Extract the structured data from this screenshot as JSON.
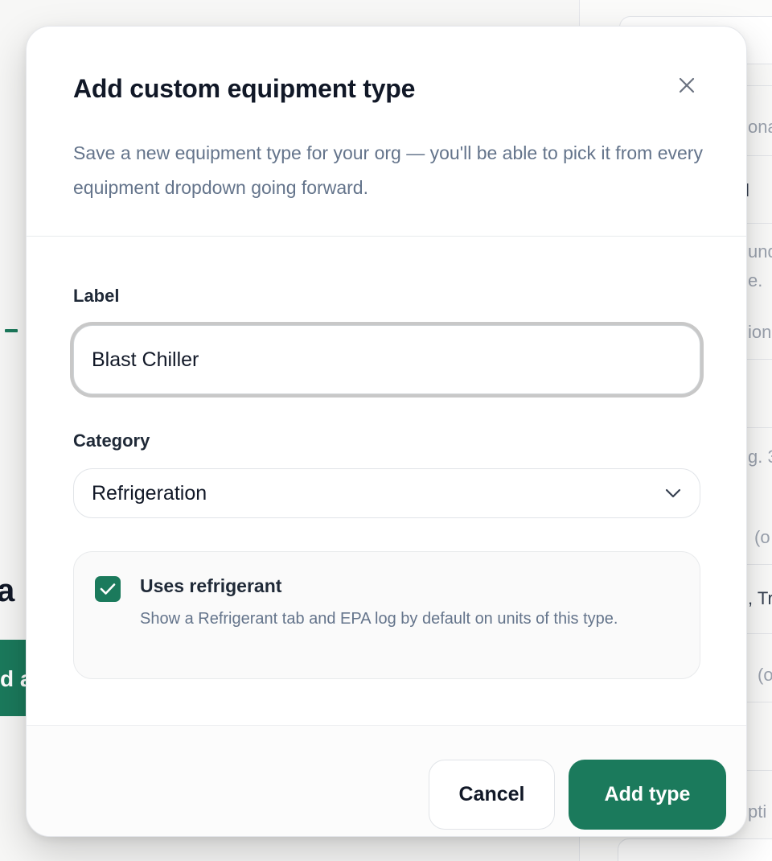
{
  "background": {
    "left_big_text": "a",
    "left_button_text": "d a",
    "right_fragments": [
      "ona",
      "l",
      "und",
      "e.",
      "ion",
      "g. 3",
      "(o",
      ", Tr",
      "(o",
      "pti"
    ]
  },
  "modal": {
    "title": "Add custom equipment type",
    "description": "Save a new equipment type for your org — you'll be able to pick it from every equipment dropdown going forward.",
    "label_field": {
      "label": "Label",
      "value": "Blast Chiller"
    },
    "category_field": {
      "label": "Category",
      "selected": "Refrigeration"
    },
    "refrigerant_option": {
      "checked": true,
      "title": "Uses refrigerant",
      "description": "Show a Refrigerant tab and EPA log by default on units of this type."
    },
    "footer": {
      "cancel_label": "Cancel",
      "submit_label": "Add type"
    }
  },
  "colors": {
    "accent": "#1b7a5c",
    "muted_text": "#64748b",
    "border": "#e1e4e8"
  },
  "icons": {
    "close": "close-icon",
    "chevron": "chevron-down-icon",
    "check": "checkmark-icon"
  }
}
